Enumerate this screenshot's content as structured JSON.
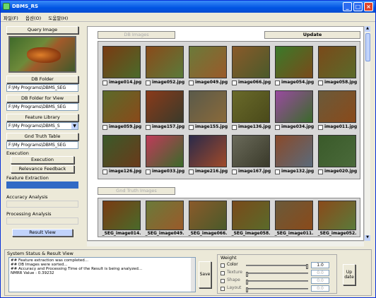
{
  "window": {
    "title": "DBMS_RS",
    "controls": [
      "minimize-icon",
      "maximize-icon",
      "close-icon"
    ]
  },
  "menu": [
    "파일(F)",
    "옵션(O)",
    "도움말(H)"
  ],
  "left_panel": {
    "query_image_label": "Query Image",
    "db_folder_label": "DB Folder",
    "db_folder_path": "F:\\My Programs\\DBMS_SEG",
    "db_folder_view_label": "DB Folder for View",
    "db_folder_view_path": "F:\\My Programs\\DBMS_SEG",
    "feature_library_label": "Feature Library",
    "feature_library_value": "F:\\My Programs\\DBMS_S",
    "gnd_truth_label": "Gnd Truth Table",
    "gnd_truth_path": "F:\\My Programs\\DBMS_SEG",
    "execution_label": "Execution",
    "execution_button": "Execution",
    "relevance_button": "Relevance Feedback",
    "feature_extraction_label": "Feature Extraction",
    "accuracy_label": "Accuracy Analysis",
    "processing_label": "Processing Analysis",
    "result_view_button": "Result View"
  },
  "right_panel": {
    "db_images_caption": "DB Images",
    "update_button": "Update",
    "db_images": [
      {
        "name": "image014.jpg",
        "c1": "#7a3a12",
        "c2": "#4a6a2a"
      },
      {
        "name": "image052.jpg",
        "c1": "#8a4a1a",
        "c2": "#5a7a3a"
      },
      {
        "name": "image049.jpg",
        "c1": "#6a7a3a",
        "c2": "#9a5a2a"
      },
      {
        "name": "image066.jpg",
        "c1": "#8a5a2a",
        "c2": "#4a5a2a"
      },
      {
        "name": "image054.jpg",
        "c1": "#3a7a2a",
        "c2": "#7a4a1a"
      },
      {
        "name": "image058.jpg",
        "c1": "#7a4a1a",
        "c2": "#5a6a2a"
      },
      {
        "name": "image059.jpg",
        "c1": "#5a6a2a",
        "c2": "#8a4a1a"
      },
      {
        "name": "image157.jpg",
        "c1": "#8a3a1a",
        "c2": "#3a3a2a"
      },
      {
        "name": "image155.jpg",
        "c1": "#5a5a4a",
        "c2": "#8a6a3a"
      },
      {
        "name": "image136.jpg",
        "c1": "#6a6a2a",
        "c2": "#4a4a1a"
      },
      {
        "name": "image034.jpg",
        "c1": "#9a4aa0",
        "c2": "#3a6a2a"
      },
      {
        "name": "image011.jpg",
        "c1": "#6a5a3a",
        "c2": "#8a4a1a"
      },
      {
        "name": "image126.jpg",
        "c1": "#3a5a2a",
        "c2": "#6a3a1a"
      },
      {
        "name": "image033.jpg",
        "c1": "#c03a5a",
        "c2": "#3a6a2a"
      },
      {
        "name": "image216.jpg",
        "c1": "#2a2a4a",
        "c2": "#a04a2a"
      },
      {
        "name": "image167.jpg",
        "c1": "#6a6a5a",
        "c2": "#3a3a2a"
      },
      {
        "name": "image132.jpg",
        "c1": "#8a4a2a",
        "c2": "#5a6a7a"
      },
      {
        "name": "image020.jpg",
        "c1": "#3a5a2a",
        "c2": "#4a6a3a"
      }
    ],
    "gnd_truth_caption": "Gnd Truth Images",
    "gnd_truth_images": [
      {
        "name": "_SEG_image014.",
        "c1": "#7a3a12",
        "c2": "#4a6a2a"
      },
      {
        "name": "_SEG_image049.",
        "c1": "#6a7a3a",
        "c2": "#9a5a2a"
      },
      {
        "name": "_SEG_image066.",
        "c1": "#8a5a2a",
        "c2": "#4a5a2a"
      },
      {
        "name": "_SEG_image058.",
        "c1": "#7a4a1a",
        "c2": "#5a6a2a"
      },
      {
        "name": "_SEG_image011.",
        "c1": "#6a5a3a",
        "c2": "#8a4a1a"
      },
      {
        "name": "_SEG_image052.",
        "c1": "#8a4a1a",
        "c2": "#5a7a3a"
      }
    ]
  },
  "status": {
    "title": "System Status & Result View",
    "lines": [
      "## Feature extraction was completed...",
      "## DB Images were sorted...",
      "## Accuracy and Processing Time of the Result is being analyzed...",
      "NMRR Value : 0.39232"
    ],
    "save_button": "Save"
  },
  "weight": {
    "title": "Weight",
    "rows": [
      {
        "label": "Color",
        "value": "1.0",
        "level": 1.0,
        "enabled": true
      },
      {
        "label": "Texture",
        "value": "0.0",
        "level": 0.0,
        "enabled": false
      },
      {
        "label": "Shape",
        "value": "0.0",
        "level": 0.0,
        "enabled": false
      },
      {
        "label": "Layout",
        "value": "0.0",
        "level": 0.0,
        "enabled": false
      }
    ],
    "update_button": "Up date"
  }
}
